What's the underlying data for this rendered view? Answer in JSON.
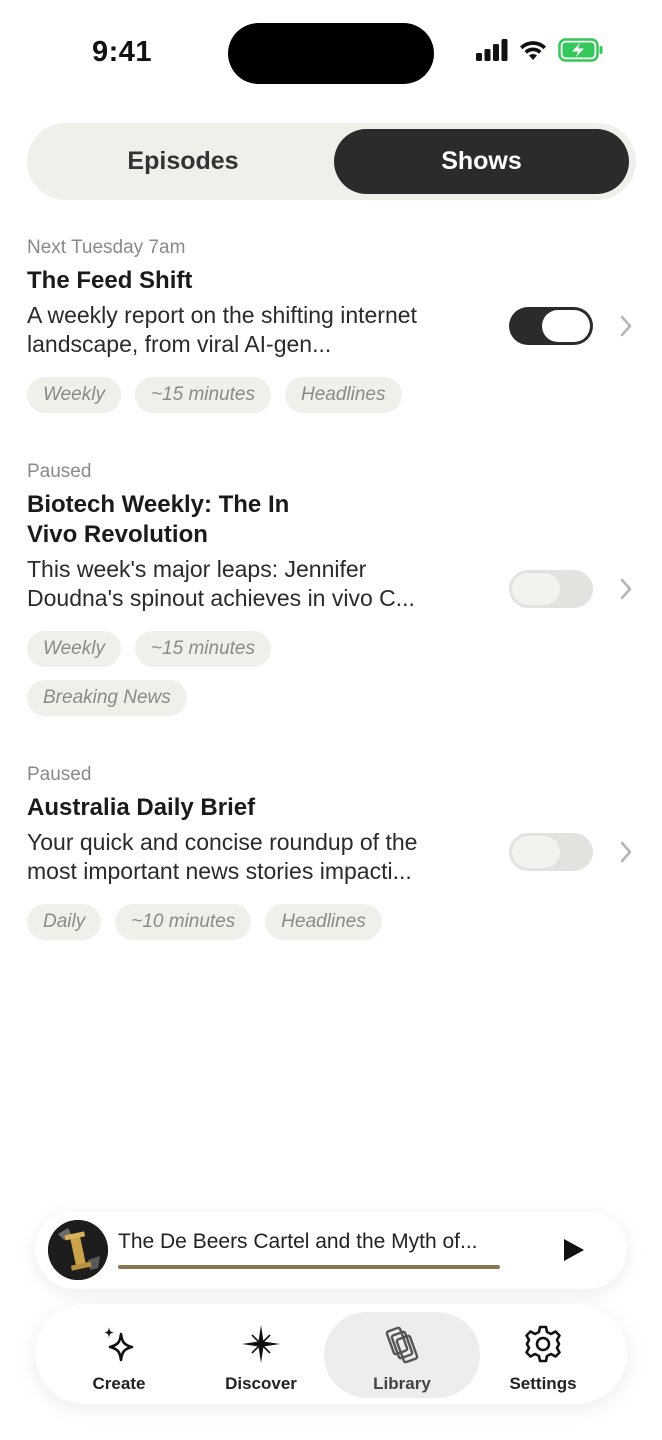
{
  "status_bar": {
    "time": "9:41"
  },
  "segmented": {
    "tabs": [
      {
        "label": "Episodes",
        "selected": false
      },
      {
        "label": "Shows",
        "selected": true
      }
    ]
  },
  "shows": [
    {
      "status": "Next Tuesday 7am",
      "title": "The Feed Shift",
      "description": "A weekly report on the shifting internet landscape, from viral AI-gen...",
      "enabled": true,
      "tags": [
        "Weekly",
        "~15 minutes",
        "Headlines"
      ]
    },
    {
      "status": "Paused",
      "title": "Biotech Weekly: The In Vivo Revolution",
      "description": "This week's major leaps: Jennifer Doudna's spinout achieves in vivo C...",
      "enabled": false,
      "tags": [
        "Weekly",
        "~15 minutes",
        "Breaking News"
      ]
    },
    {
      "status": "Paused",
      "title": "Australia Daily Brief",
      "description": "Your quick and concise roundup of the most important news stories impacti...",
      "enabled": false,
      "tags": [
        "Daily",
        "~10 minutes",
        "Headlines"
      ]
    }
  ],
  "mini_player": {
    "title": "The De Beers Cartel and the Myth of...",
    "progress": 1.0,
    "play_icon": "play-icon"
  },
  "tab_bar": {
    "items": [
      {
        "label": "Create",
        "icon": "sparkles-icon",
        "active": false
      },
      {
        "label": "Discover",
        "icon": "star-compass-icon",
        "active": false
      },
      {
        "label": "Library",
        "icon": "stacked-pages-icon",
        "active": true
      },
      {
        "label": "Settings",
        "icon": "gear-icon",
        "active": false
      }
    ]
  },
  "colors": {
    "accent_dark": "#2b2b2b",
    "chip_bg": "#f1efe9",
    "progress": "#8b7752",
    "battery": "#34c759"
  }
}
